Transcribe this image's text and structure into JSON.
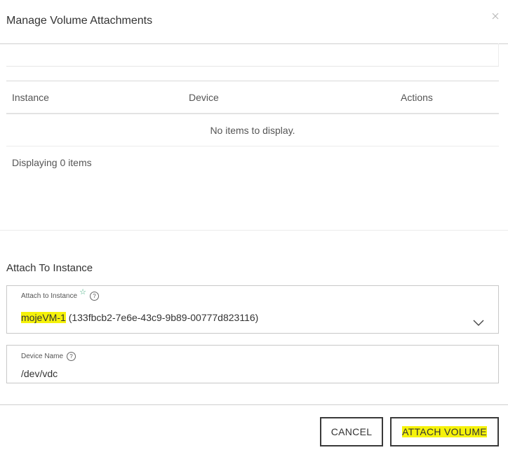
{
  "modal": {
    "title": "Manage Volume Attachments",
    "close_icon": "close-icon"
  },
  "attachments_table": {
    "columns": [
      "Instance",
      "Device",
      "Actions"
    ],
    "rows": [],
    "empty_message": "No items to display.",
    "count_text": "Displaying 0 items"
  },
  "attach_section": {
    "title": "Attach To Instance",
    "instance_field": {
      "label": "Attach to Instance",
      "required_icon": "star-icon",
      "help_icon": "question-icon",
      "selected_name": "mojeVM-1",
      "selected_id": "(133fbcb2-7e6e-43c9-9b89-00777d823116)",
      "dropdown_icon": "chevron-down-icon"
    },
    "device_field": {
      "label": "Device Name",
      "help_icon": "question-icon",
      "value": "/dev/vdc"
    }
  },
  "footer": {
    "cancel_label": "CANCEL",
    "attach_label": "ATTACH VOLUME"
  },
  "colors": {
    "highlight": "#f5f20a",
    "required_star": "#3aaa7a",
    "button_border": "#3a3a3a",
    "divider": "#cfcfcf"
  }
}
